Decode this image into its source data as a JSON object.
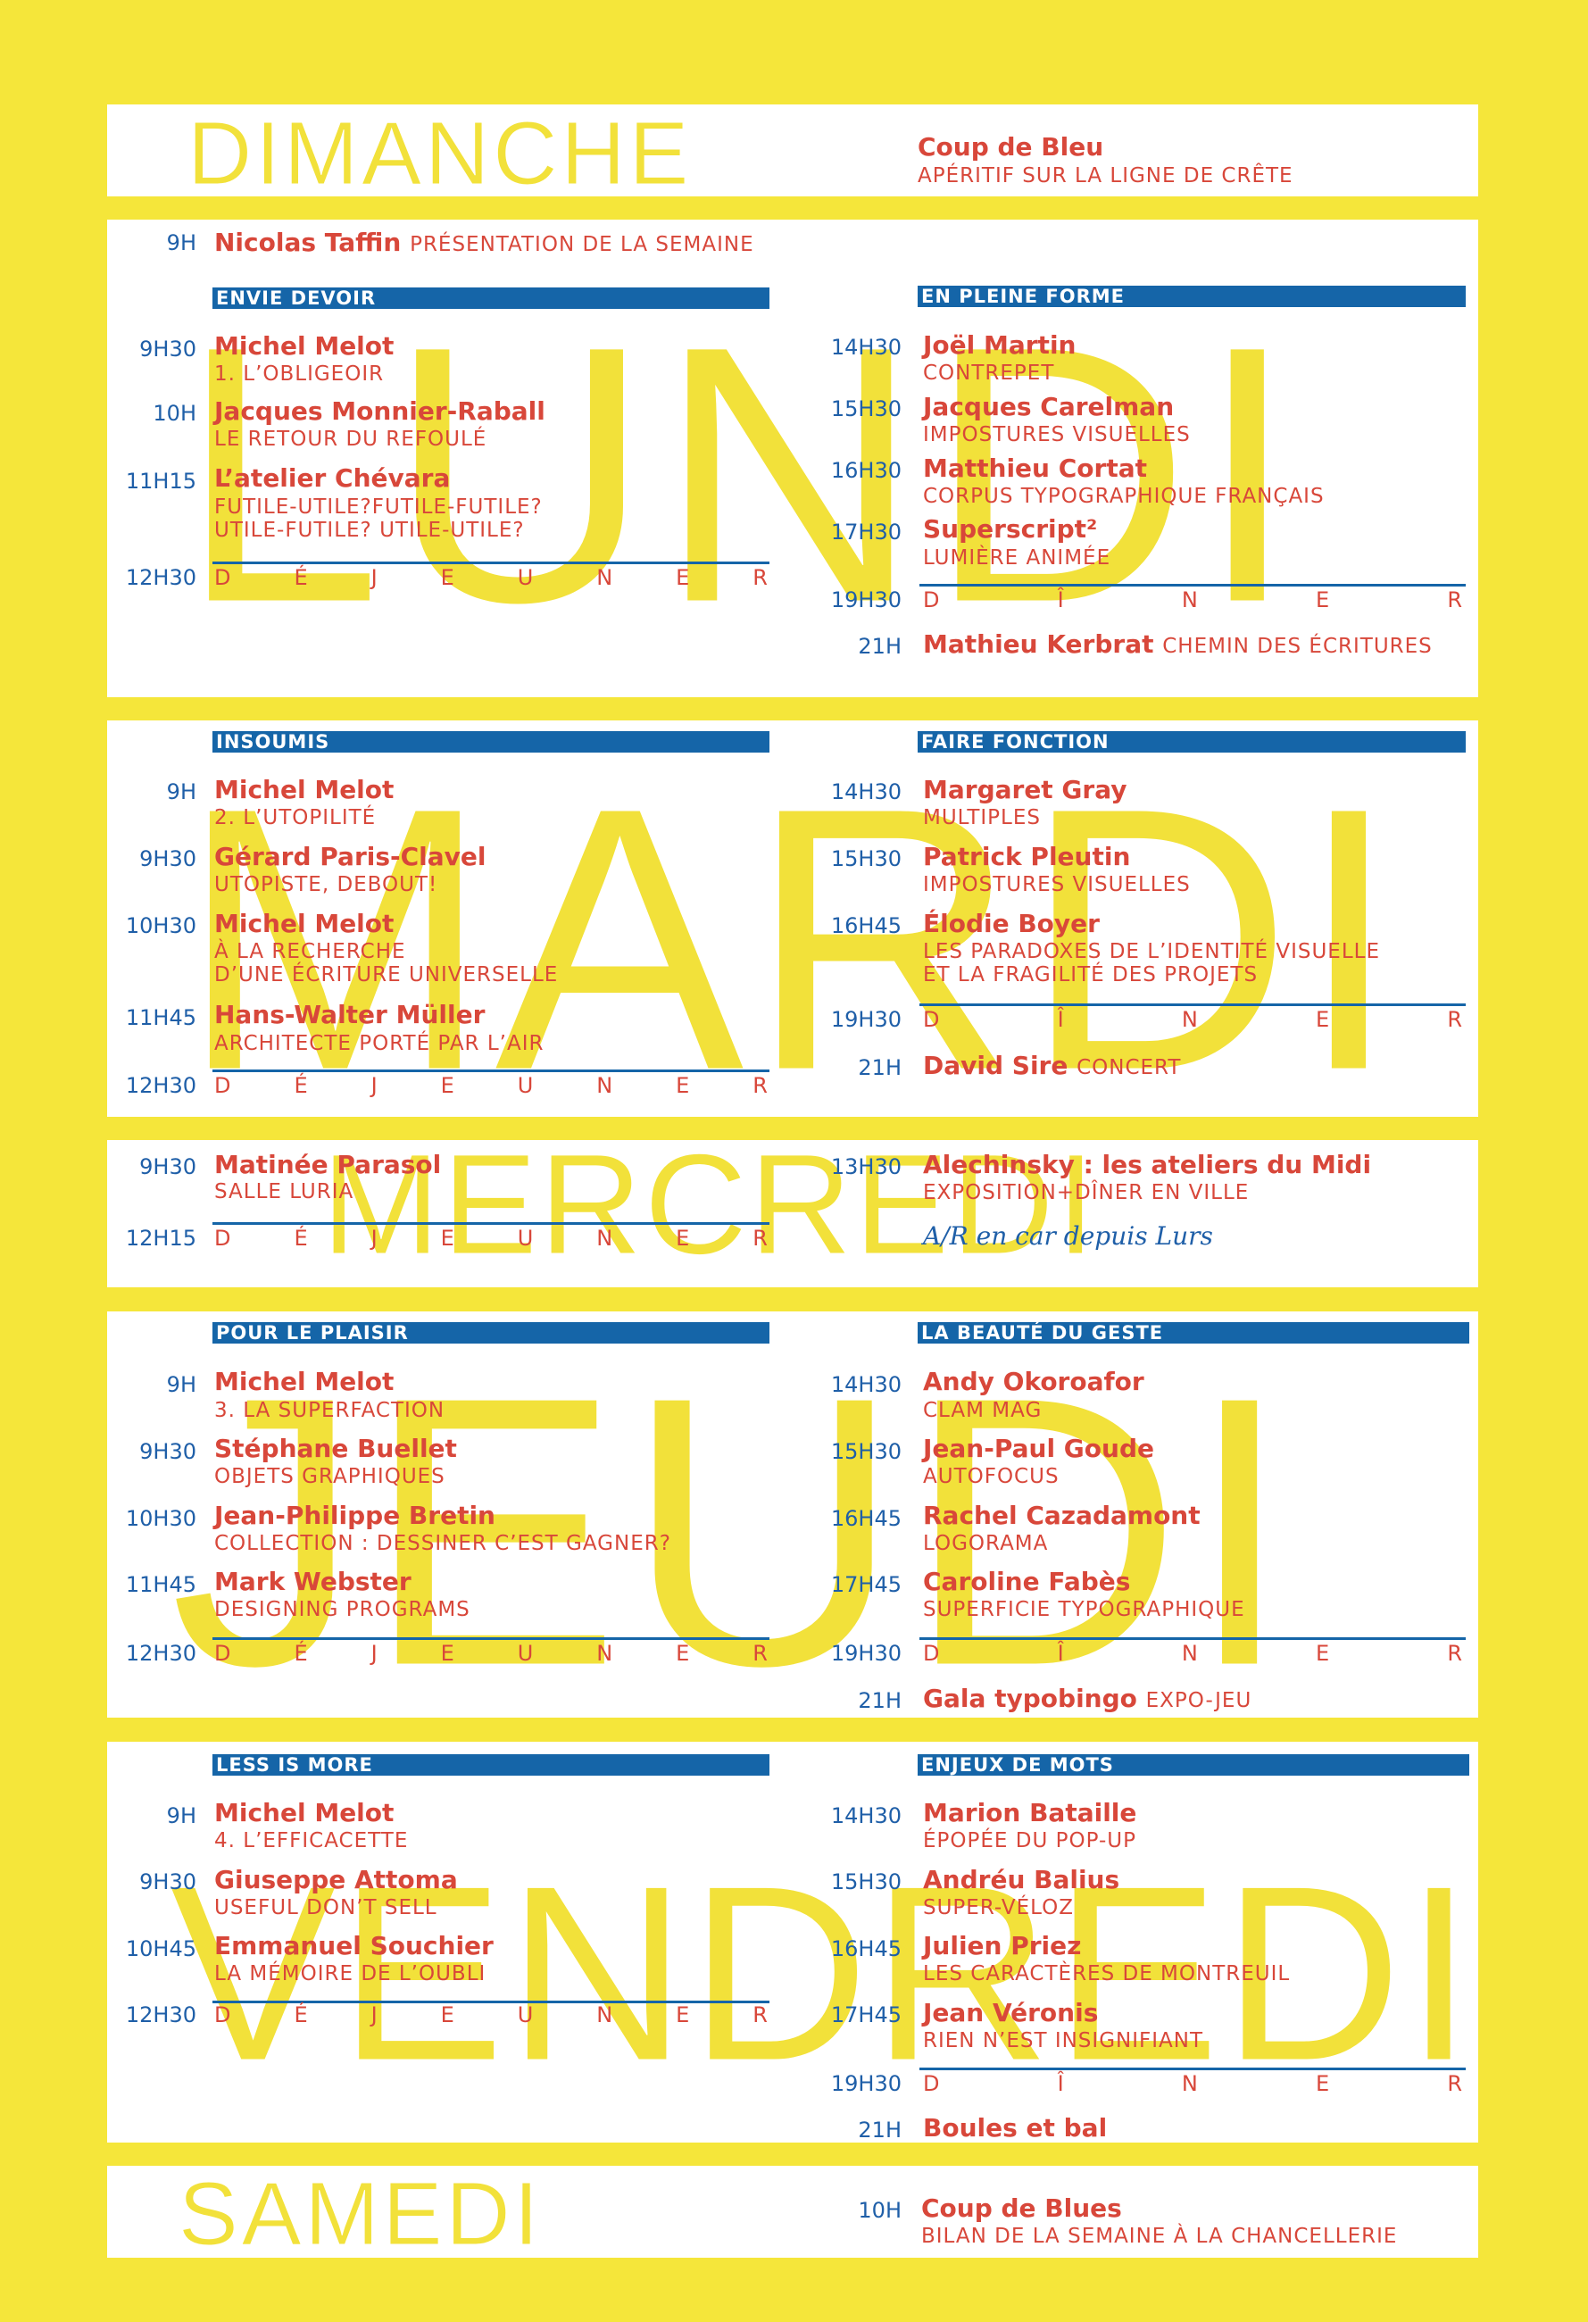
{
  "colors": {
    "background": "#f5e63a",
    "panel": "#ffffff",
    "accent_red": "#d8473a",
    "accent_blue": "#1565a8",
    "day_yellow": "#f2e13a"
  },
  "days": {
    "dimanche": {
      "label": "DIMANCHE",
      "event": {
        "name": "Coup de Bleu",
        "sub": "APÉRITIF SUR LA LIGNE DE CRÊTE"
      }
    },
    "lundi": {
      "label": "LUNDI",
      "intro": {
        "time": "9H",
        "name": "Nicolas Taffin",
        "sub": "PRÉSENTATION DE LA SEMAINE"
      },
      "morning": {
        "header": "ENVIE DEVOIR",
        "events": [
          {
            "time": "9H30",
            "name": "Michel Melot",
            "sub": "1. L’OBLIGEOIR"
          },
          {
            "time": "10H",
            "name": "Jacques Monnier-Raball",
            "sub": "LE RETOUR DU REFOULÉ"
          },
          {
            "time": "11H15",
            "name": "L’atelier Chévara",
            "sub": "FUTILE-UTILE?FUTILE-FUTILE?",
            "sub2": "UTILE-FUTILE? UTILE-UTILE?"
          }
        ],
        "meal_time": "12H30",
        "meal": "DÉJEUNER"
      },
      "afternoon": {
        "header": "EN PLEINE FORME",
        "events": [
          {
            "time": "14H30",
            "name": "Joël Martin",
            "sub": "CONTREPET"
          },
          {
            "time": "15H30",
            "name": "Jacques Carelman",
            "sub": "IMPOSTURES VISUELLES"
          },
          {
            "time": "16H30",
            "name": "Matthieu Cortat",
            "sub": "CORPUS TYPOGRAPHIQUE FRANÇAIS"
          },
          {
            "time": "17H30",
            "name": "Superscript²",
            "sub": "LUMIÈRE ANIMÉE"
          }
        ],
        "meal_time": "19H30",
        "meal": "DÎNER",
        "evening": {
          "time": "21H",
          "name": "Mathieu Kerbrat",
          "sub": "CHEMIN DES ÉCRITURES"
        }
      }
    },
    "mardi": {
      "label": "MARDI",
      "morning": {
        "header": "INSOUMIS",
        "events": [
          {
            "time": "9H",
            "name": "Michel Melot",
            "sub": "2. L’UTOPILITÉ"
          },
          {
            "time": "9H30",
            "name": "Gérard Paris-Clavel",
            "sub": "UTOPISTE, DEBOUT!"
          },
          {
            "time": "10H30",
            "name": "Michel Melot",
            "sub": "À LA RECHERCHE",
            "sub2": "D’UNE ÉCRITURE UNIVERSELLE"
          },
          {
            "time": "11H45",
            "name": "Hans-Walter Müller",
            "sub": "ARCHITECTE PORTÉ PAR L’AIR"
          }
        ],
        "meal_time": "12H30",
        "meal": "DÉJEUNER"
      },
      "afternoon": {
        "header": "FAIRE FONCTION",
        "events": [
          {
            "time": "14H30",
            "name": "Margaret Gray",
            "sub": "MULTIPLES"
          },
          {
            "time": "15H30",
            "name": "Patrick Pleutin",
            "sub": "IMPOSTURES VISUELLES"
          },
          {
            "time": "16H45",
            "name": "Élodie Boyer",
            "sub": "LES PARADOXES DE L’IDENTITÉ VISUELLE",
            "sub2": "ET LA FRAGILITÉ DES PROJETS"
          }
        ],
        "meal_time": "19H30",
        "meal": "DÎNER",
        "evening": {
          "time": "21H",
          "name": "David Sire",
          "sub": "CONCERT"
        }
      }
    },
    "mercredi": {
      "label": "MERCREDI",
      "morning": {
        "time": "9H30",
        "name": "Matinée Parasol",
        "sub": "SALLE LURIA",
        "meal_time": "12H15",
        "meal": "DÉJEUNER"
      },
      "afternoon": {
        "time": "13H30",
        "name": "Alechinsky : les ateliers du Midi",
        "sub": "EXPOSITION+DÎNER EN VILLE",
        "note": "A/R en car depuis Lurs"
      }
    },
    "jeudi": {
      "label": "JEUDI",
      "morning": {
        "header": "POUR LE PLAISIR",
        "events": [
          {
            "time": "9H",
            "name": "Michel Melot",
            "sub": "3. LA SUPERFACTION"
          },
          {
            "time": "9H30",
            "name": "Stéphane Buellet",
            "sub": "OBJETS GRAPHIQUES"
          },
          {
            "time": "10H30",
            "name": "Jean-Philippe Bretin",
            "sub": "COLLECTION : DESSINER C’EST GAGNER?"
          },
          {
            "time": "11H45",
            "name": "Mark Webster",
            "sub": "DESIGNING PROGRAMS"
          }
        ],
        "meal_time": "12H30",
        "meal": "DÉJEUNER"
      },
      "afternoon": {
        "header": "LA BEAUTÉ DU GESTE",
        "events": [
          {
            "time": "14H30",
            "name": "Andy Okoroafor",
            "sub": "CLAM MAG"
          },
          {
            "time": "15H30",
            "name": "Jean-Paul Goude",
            "sub": "AUTOFOCUS"
          },
          {
            "time": "16H45",
            "name": "Rachel Cazadamont",
            "sub": "LOGORAMA"
          },
          {
            "time": "17H45",
            "name": "Caroline Fabès",
            "sub": "SUPERFICIE TYPOGRAPHIQUE"
          }
        ],
        "meal_time": "19H30",
        "meal": "DÎNER",
        "evening": {
          "time": "21H",
          "name": "Gala typobingo",
          "sub": "EXPO-JEU"
        }
      }
    },
    "vendredi": {
      "label": "VENDREDI",
      "morning": {
        "header": "LESS IS MORE",
        "events": [
          {
            "time": "9H",
            "name": "Michel Melot",
            "sub": "4. L’EFFICACETTE"
          },
          {
            "time": "9H30",
            "name": "Giuseppe Attoma",
            "sub": "USEFUL DON’T SELL"
          },
          {
            "time": "10H45",
            "name": "Emmanuel Souchier",
            "sub": "LA MÉMOIRE DE L’OUBLI"
          }
        ],
        "meal_time": "12H30",
        "meal": "DÉJEUNER"
      },
      "afternoon": {
        "header": "ENJEUX DE MOTS",
        "events": [
          {
            "time": "14H30",
            "name": "Marion Bataille",
            "sub": "ÉPOPÉE DU POP-UP"
          },
          {
            "time": "15H30",
            "name": "Andréu Balius",
            "sub": "SUPER-VÉLOZ"
          },
          {
            "time": "16H45",
            "name": "Julien Priez",
            "sub": "LES CARACTÈRES DE MONTREUIL"
          },
          {
            "time": "17H45",
            "name": "Jean Véronis",
            "sub": "RIEN N’EST INSIGNIFIANT"
          }
        ],
        "meal_time": "19H30",
        "meal": "DÎNER",
        "evening": {
          "time": "21H",
          "name": "Boules et bal"
        }
      }
    },
    "samedi": {
      "label": "SAMEDI",
      "event": {
        "time": "10H",
        "name": "Coup de Blues",
        "sub": "BILAN DE LA SEMAINE À LA CHANCELLERIE"
      }
    }
  }
}
